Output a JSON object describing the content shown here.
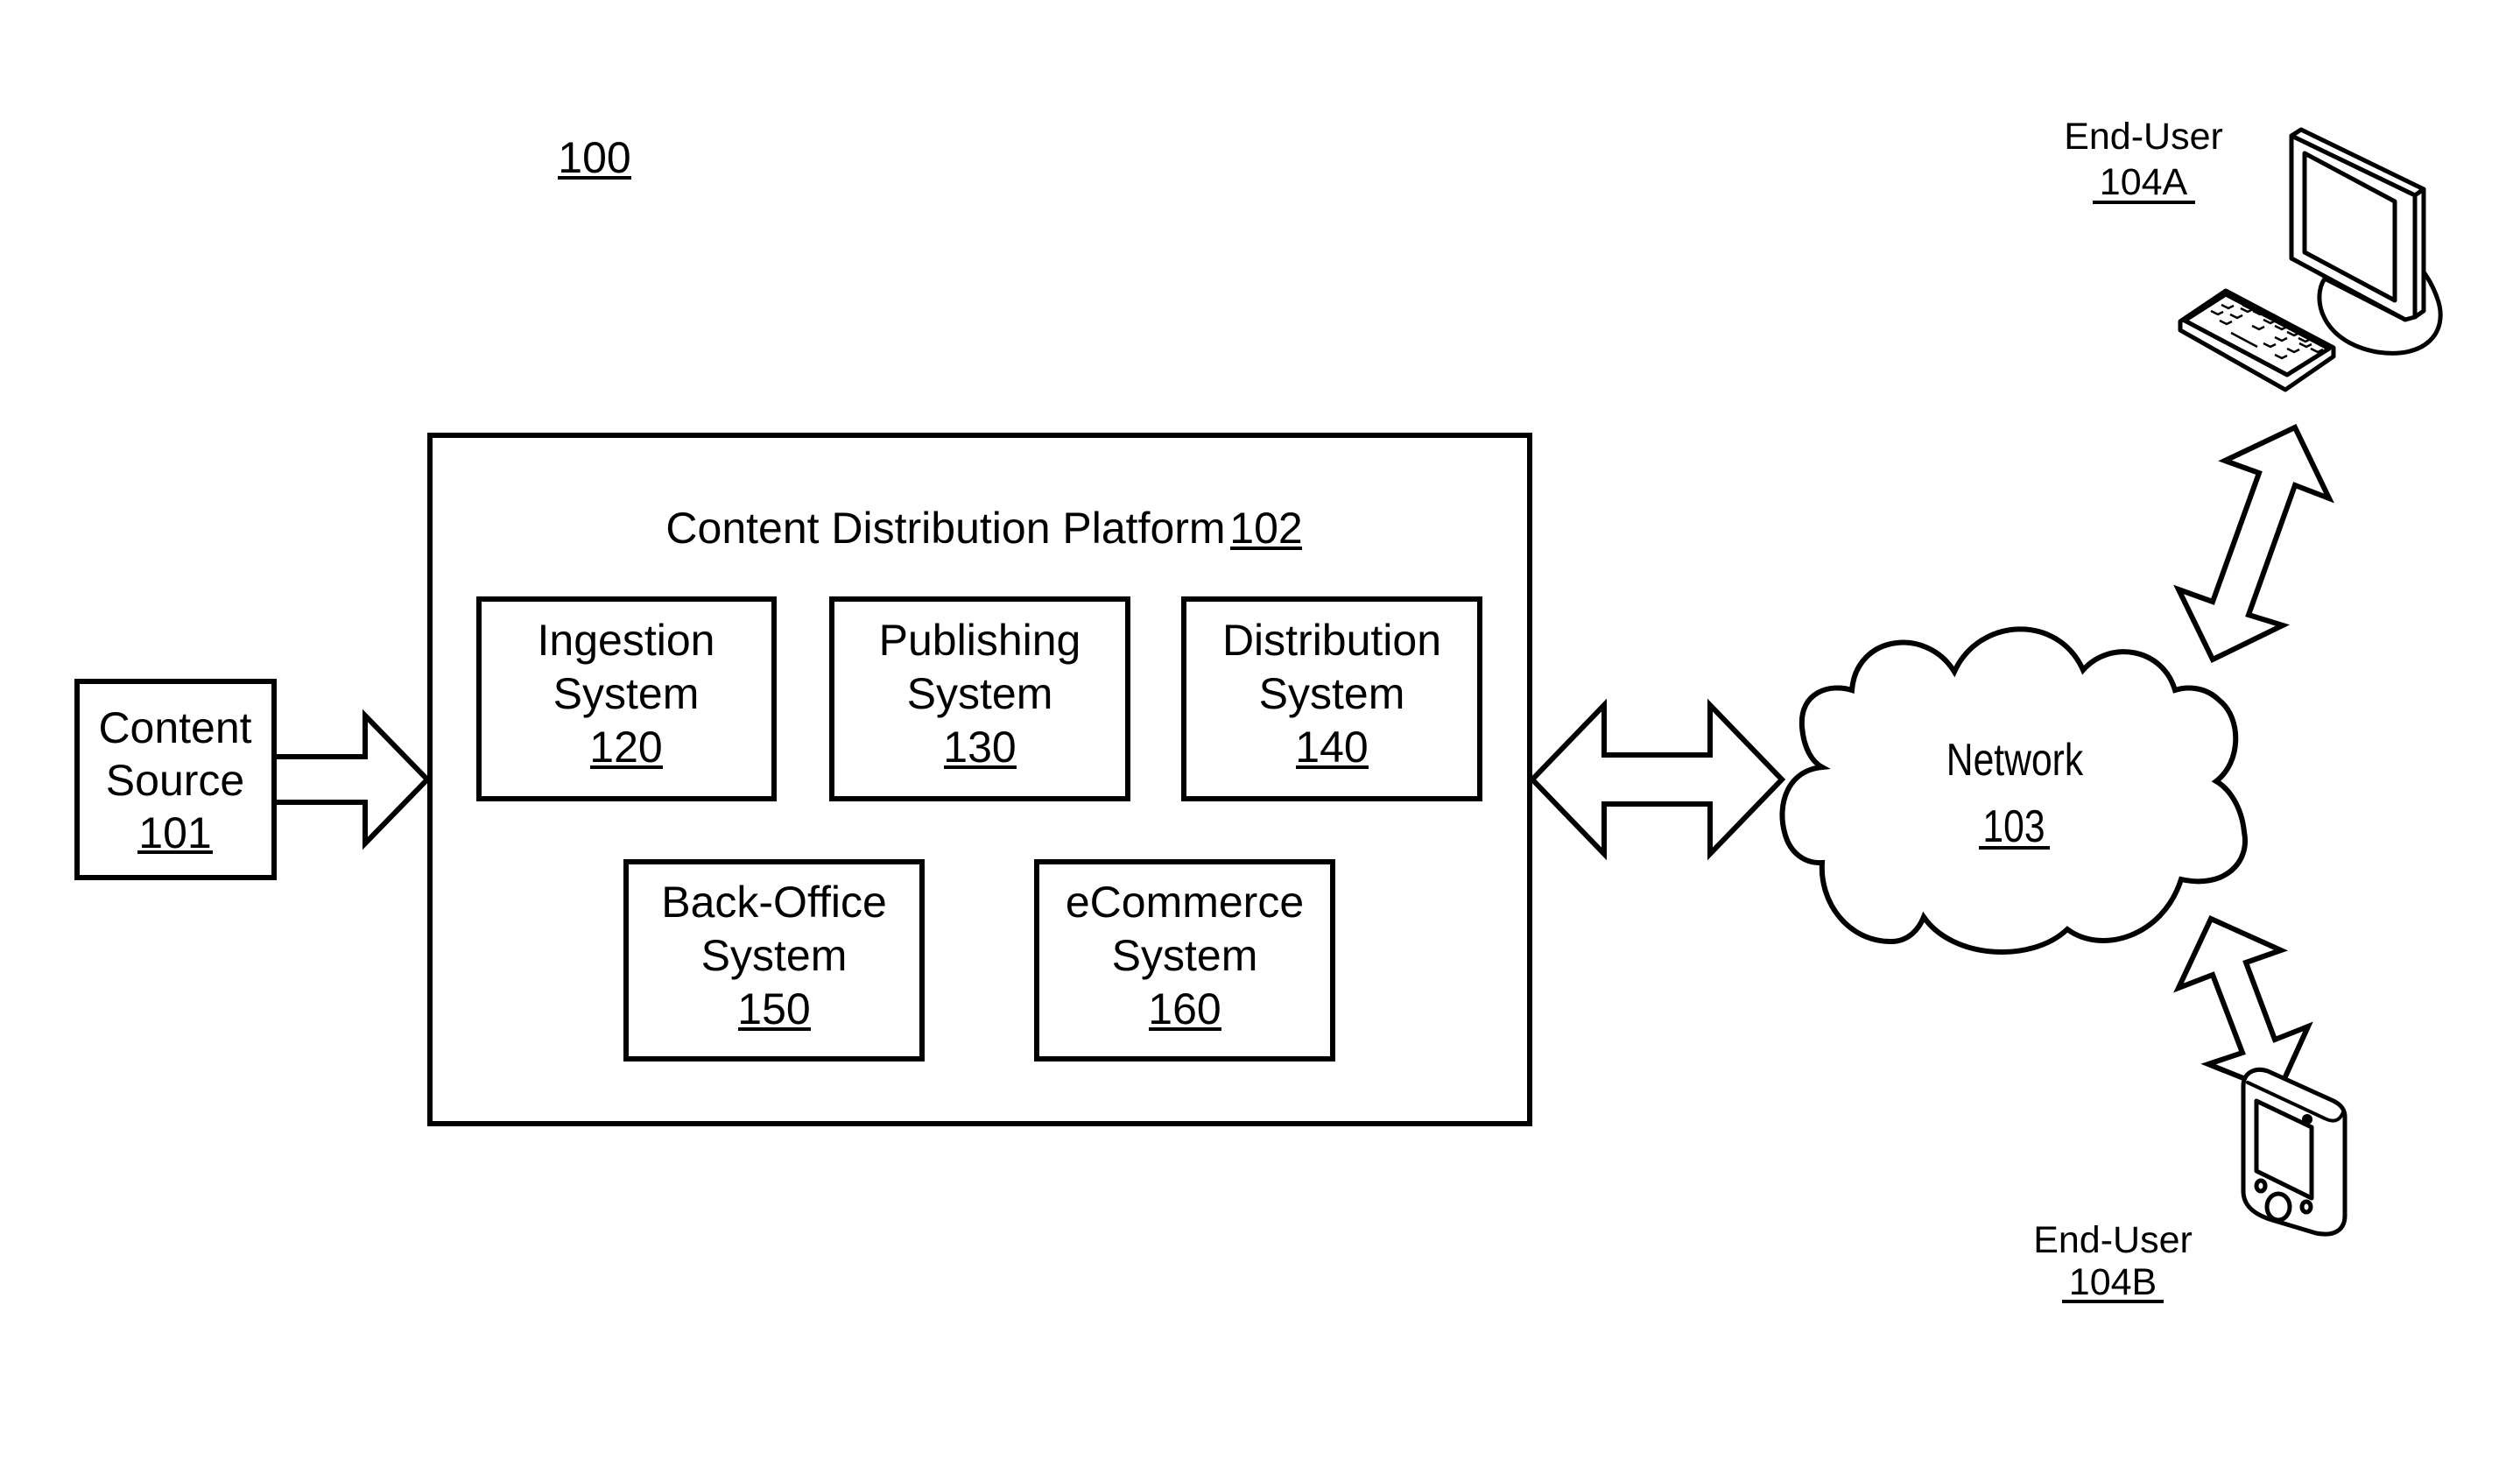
{
  "figure_label": "100",
  "content_source": {
    "line1": "Content",
    "line2": "Source",
    "ref": "101"
  },
  "platform": {
    "title": "Content Distribution Platform",
    "ref": "102",
    "systems": [
      {
        "line1": "Ingestion",
        "line2": "System",
        "ref": "120"
      },
      {
        "line1": "Publishing",
        "line2": "System",
        "ref": "130"
      },
      {
        "line1": "Distribution",
        "line2": "System",
        "ref": "140"
      },
      {
        "line1": "Back-Office",
        "line2": "System",
        "ref": "150"
      },
      {
        "line1": "eCommerce",
        "line2": "System",
        "ref": "160"
      }
    ]
  },
  "network": {
    "label": "Network",
    "ref": "103"
  },
  "end_users": [
    {
      "label": "End-User",
      "ref": "104A",
      "device": "desktop-computer"
    },
    {
      "label": "End-User",
      "ref": "104B",
      "device": "mobile-handheld"
    }
  ],
  "colors": {
    "stroke": "#000000",
    "background": "#ffffff"
  }
}
